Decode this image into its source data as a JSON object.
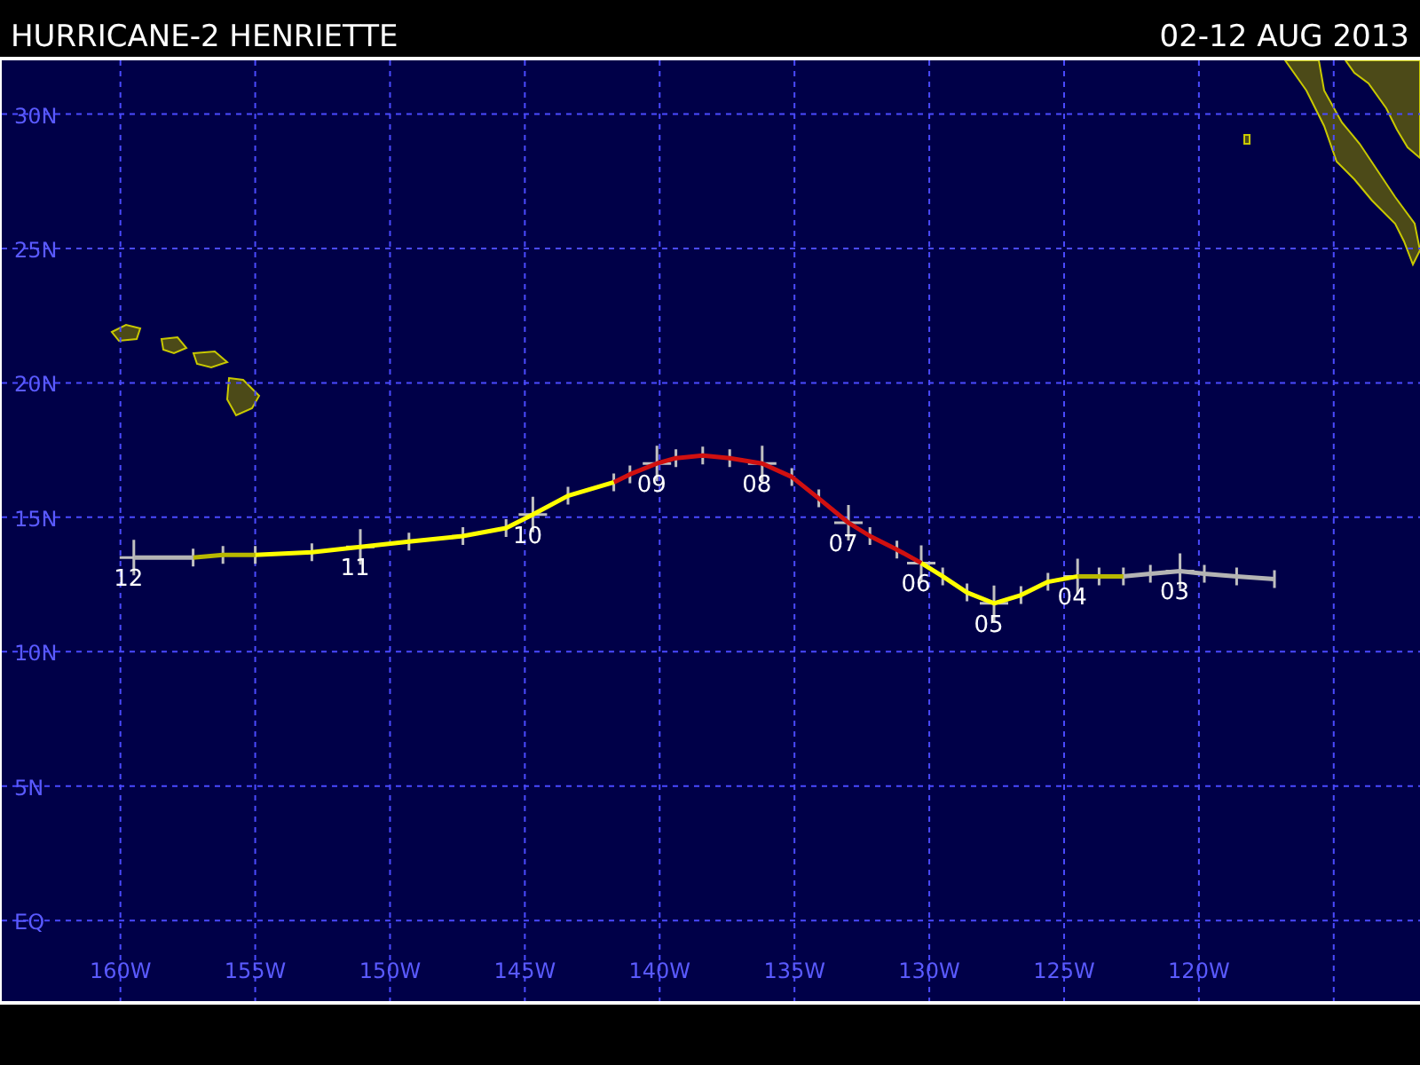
{
  "header": {
    "title": "HURRICANE-2 HENRIETTE",
    "dates": "02-12 AUG 2013"
  },
  "map": {
    "chart_data": {
      "type": "line",
      "grid": true,
      "xlim": [
        -164.4,
        -111.8
      ],
      "ylim": [
        -3.0,
        32.0
      ],
      "xticks": [
        {
          "value": -160,
          "label": "160W"
        },
        {
          "value": -155,
          "label": "155W"
        },
        {
          "value": -150,
          "label": "150W"
        },
        {
          "value": -145,
          "label": "145W"
        },
        {
          "value": -140,
          "label": "140W"
        },
        {
          "value": -135,
          "label": "135W"
        },
        {
          "value": -130,
          "label": "130W"
        },
        {
          "value": -125,
          "label": "125W"
        },
        {
          "value": -120,
          "label": "120W"
        }
      ],
      "yticks": [
        {
          "value": 30,
          "label": "30N"
        },
        {
          "value": 25,
          "label": "25N"
        },
        {
          "value": 20,
          "label": "20N"
        },
        {
          "value": 15,
          "label": "15N"
        },
        {
          "value": 10,
          "label": "10N"
        },
        {
          "value": 5,
          "label": "5N"
        },
        {
          "value": 0,
          "label": "EQ"
        }
      ],
      "x": [
        -117.2,
        -118.6,
        -119.8,
        -120.7,
        -121.8,
        -122.8,
        -123.7,
        -124.5,
        -125.6,
        -126.6,
        -127.6,
        -128.6,
        -129.5,
        -130.3,
        -131.2,
        -132.2,
        -133.0,
        -134.1,
        -135.1,
        -136.2,
        -137.4,
        -138.4,
        -139.4,
        -140.1,
        -141.1,
        -141.7,
        -143.4,
        -144.7,
        -145.7,
        -147.3,
        -149.3,
        -151.1,
        -152.9,
        -155.0,
        -156.2,
        -157.3,
        -159.5
      ],
      "series": [
        {
          "color": "#b4b4b4",
          "values": [
            12.7,
            12.8,
            12.9,
            13.0,
            12.9,
            12.8,
            null,
            null,
            null,
            null,
            null,
            null,
            null,
            null,
            null,
            null,
            null,
            null,
            null,
            null,
            null,
            null,
            null,
            null,
            null,
            null,
            null,
            null,
            null,
            null,
            null,
            null,
            null,
            null,
            null,
            null,
            null
          ]
        },
        {
          "color": "#b8b800",
          "values": [
            null,
            null,
            null,
            null,
            null,
            12.8,
            12.8,
            12.8,
            null,
            null,
            null,
            null,
            null,
            null,
            null,
            null,
            null,
            null,
            null,
            null,
            null,
            null,
            null,
            null,
            null,
            null,
            null,
            null,
            null,
            null,
            null,
            null,
            null,
            null,
            null,
            null,
            null
          ]
        },
        {
          "color": "#ffff00",
          "values": [
            null,
            null,
            null,
            null,
            null,
            null,
            null,
            12.8,
            12.6,
            12.1,
            11.8,
            12.2,
            12.8,
            13.3,
            null,
            null,
            null,
            null,
            null,
            null,
            null,
            null,
            null,
            null,
            null,
            null,
            null,
            null,
            null,
            null,
            null,
            null,
            null,
            null,
            null,
            null,
            null
          ]
        },
        {
          "color": "#d01010",
          "values": [
            null,
            null,
            null,
            null,
            null,
            null,
            null,
            null,
            null,
            null,
            null,
            null,
            null,
            13.3,
            13.8,
            14.3,
            14.8,
            15.7,
            16.5,
            17.0,
            17.2,
            17.3,
            17.2,
            17.0,
            16.6,
            16.3,
            null,
            null,
            null,
            null,
            null,
            null,
            null,
            null,
            null,
            null,
            null
          ]
        },
        {
          "color": "#ffff00",
          "values": [
            null,
            null,
            null,
            null,
            null,
            null,
            null,
            null,
            null,
            null,
            null,
            null,
            null,
            null,
            null,
            null,
            null,
            null,
            null,
            null,
            null,
            null,
            null,
            null,
            null,
            16.3,
            15.8,
            15.1,
            14.6,
            14.3,
            14.1,
            13.9,
            13.7,
            13.6,
            null,
            null,
            null
          ]
        },
        {
          "color": "#b8b800",
          "values": [
            null,
            null,
            null,
            null,
            null,
            null,
            null,
            null,
            null,
            null,
            null,
            null,
            null,
            null,
            null,
            null,
            null,
            null,
            null,
            null,
            null,
            null,
            null,
            null,
            null,
            null,
            null,
            null,
            null,
            null,
            null,
            null,
            null,
            13.6,
            13.6,
            13.5,
            null
          ]
        },
        {
          "color": "#b4b4b4",
          "values": [
            null,
            null,
            null,
            null,
            null,
            null,
            null,
            null,
            null,
            null,
            null,
            null,
            null,
            null,
            null,
            null,
            null,
            null,
            null,
            null,
            null,
            null,
            null,
            null,
            null,
            null,
            null,
            null,
            null,
            null,
            null,
            null,
            null,
            null,
            null,
            13.5,
            13.5
          ]
        }
      ],
      "annotations": [
        {
          "x": -120.7,
          "y": 13.0,
          "text": "03"
        },
        {
          "x": -124.5,
          "y": 12.8,
          "text": "04"
        },
        {
          "x": -127.6,
          "y": 11.8,
          "text": "05"
        },
        {
          "x": -130.3,
          "y": 13.3,
          "text": "06"
        },
        {
          "x": -133.0,
          "y": 14.8,
          "text": "07"
        },
        {
          "x": -136.2,
          "y": 17.0,
          "text": "08"
        },
        {
          "x": -140.1,
          "y": 17.0,
          "text": "09"
        },
        {
          "x": -144.7,
          "y": 15.1,
          "text": "10"
        },
        {
          "x": -151.1,
          "y": 13.9,
          "text": "11"
        },
        {
          "x": -159.5,
          "y": 13.5,
          "text": "12"
        }
      ]
    }
  }
}
